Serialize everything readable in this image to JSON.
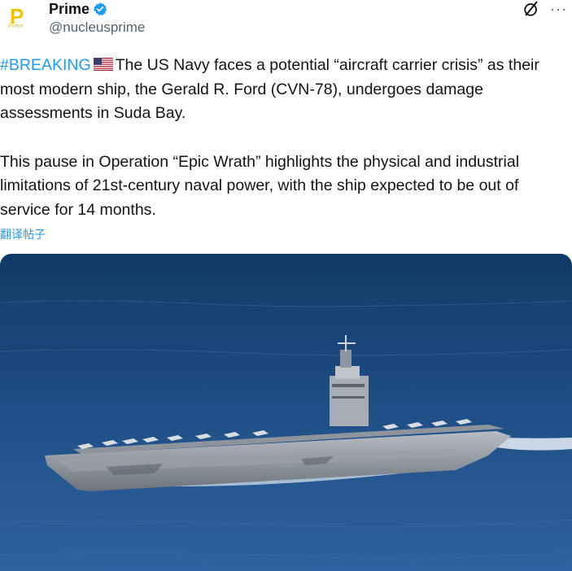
{
  "author": {
    "avatar_text": "P",
    "avatar_subtext": "Prime",
    "name": "Prime",
    "handle": "@nucleusprime",
    "verified": true
  },
  "icons": {
    "grok": "grok-icon",
    "more": "more-icon"
  },
  "tweet": {
    "hashtag": "#BREAKING",
    "flag": "us-flag",
    "paragraph1_rest": "The US Navy faces a potential “aircraft carrier crisis” as their most modern ship, the Gerald R. Ford (CVN-78), undergoes damage assessments in Suda Bay.",
    "paragraph2": "This pause in Operation “Epic Wrath” highlights the physical and industrial limitations of 21st-century naval power, with the ship expected to be out of service for 14 months.",
    "translate_label": "翻译帖子"
  },
  "colors": {
    "link": "#1d9bf0",
    "text": "#0f1419",
    "muted": "#536471",
    "avatar": "#f2c200",
    "sea": "#1f4f86"
  }
}
